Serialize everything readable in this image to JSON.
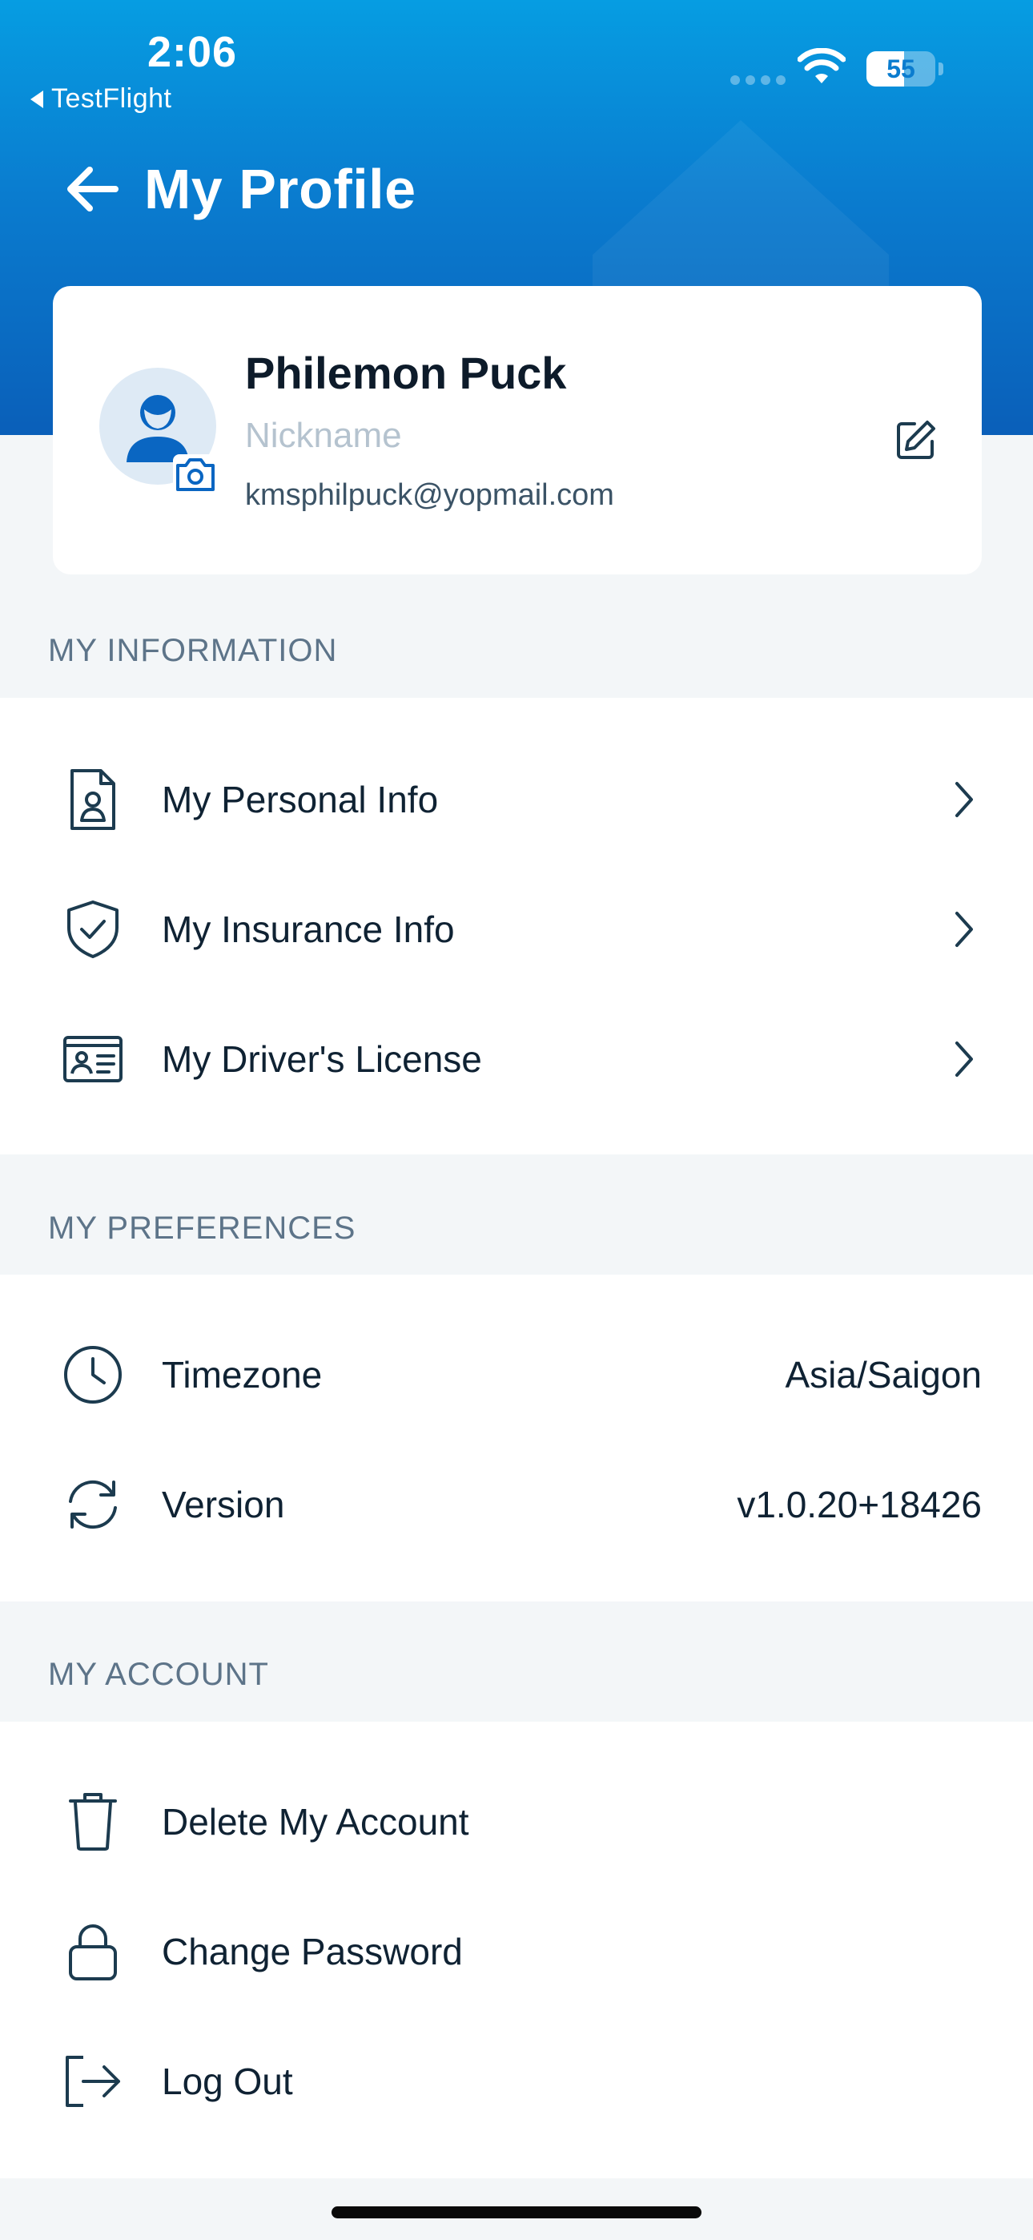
{
  "status_bar": {
    "time": "2:06",
    "back_app": "TestFlight",
    "battery": "55",
    "battery_level_percent": 55
  },
  "header": {
    "title": "My Profile"
  },
  "profile": {
    "name": "Philemon Puck",
    "nickname_placeholder": "Nickname",
    "email": "kmsphilpuck@yopmail.com"
  },
  "sections": {
    "information": {
      "title": "MY INFORMATION",
      "items": [
        {
          "label": "My Personal Info",
          "icon": "personal-info-icon"
        },
        {
          "label": "My Insurance Info",
          "icon": "shield-check-icon"
        },
        {
          "label": "My Driver's License",
          "icon": "id-card-icon"
        }
      ]
    },
    "preferences": {
      "title": "MY PREFERENCES",
      "items": [
        {
          "label": "Timezone",
          "value": "Asia/Saigon",
          "icon": "clock-icon"
        },
        {
          "label": "Version",
          "value": "v1.0.20+18426",
          "icon": "refresh-icon"
        }
      ]
    },
    "account": {
      "title": "MY ACCOUNT",
      "items": [
        {
          "label": "Delete My Account",
          "icon": "trash-icon"
        },
        {
          "label": "Change Password",
          "icon": "lock-icon"
        },
        {
          "label": "Log Out",
          "icon": "logout-icon"
        }
      ]
    }
  },
  "colors": {
    "header_top": "#069de2",
    "header_bottom": "#0a5fb9",
    "accent": "#0a66c2",
    "icon_stroke": "#1c3b4f",
    "section_bg": "#f3f6f8"
  }
}
